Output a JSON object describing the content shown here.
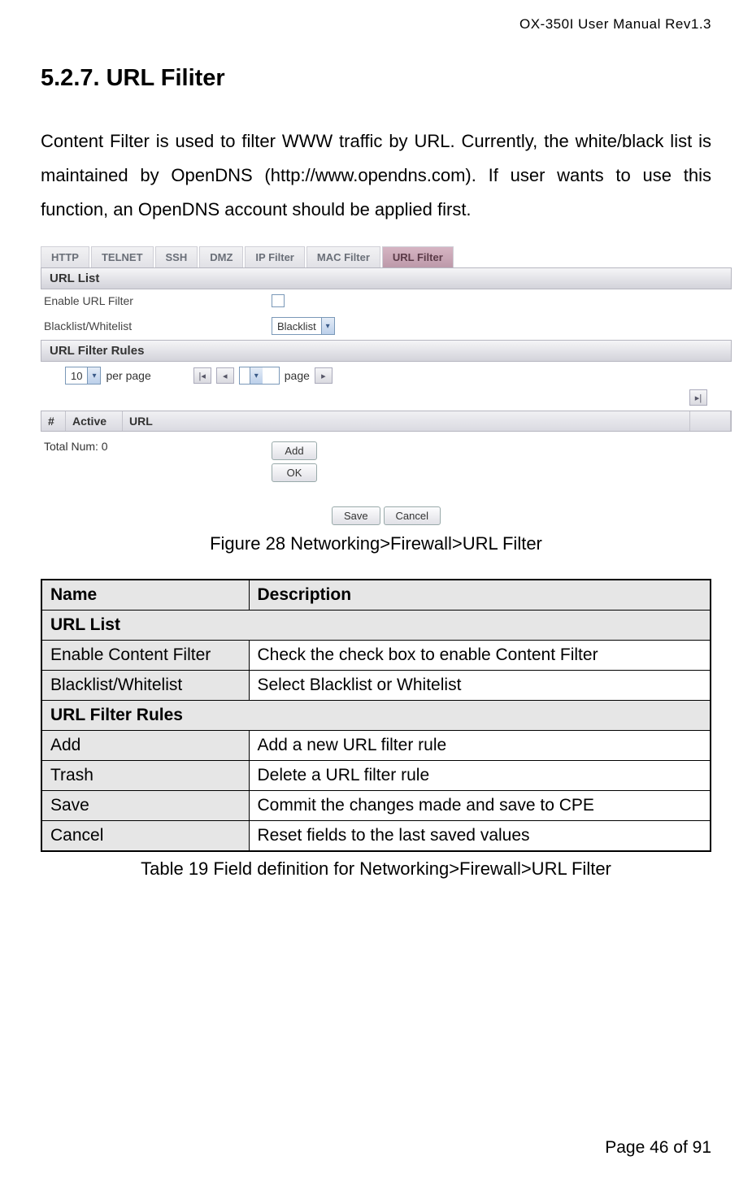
{
  "doc_header": "OX-350I  User  Manual  Rev1.3",
  "section_title": "5.2.7. URL Filiter",
  "intro": "Content Filter is used to filter WWW traffic by URL. Currently, the white/black list is maintained by OpenDNS (http://www.opendns.com). If user wants to use this function, an OpenDNS account should be applied first.",
  "screenshot": {
    "tabs": [
      "HTTP",
      "TELNET",
      "SSH",
      "DMZ",
      "IP Filter",
      "MAC Filter",
      "URL Filter"
    ],
    "active_tab_index": 6,
    "section1": "URL List",
    "enable_label": "Enable URL Filter",
    "bw_label": "Blacklist/Whitelist",
    "bw_value": "Blacklist",
    "section2": "URL Filter Rules",
    "per_page_value": "10",
    "per_page_label": "per page",
    "page_label": "page",
    "cols": {
      "num": "#",
      "active": "Active",
      "url": "URL"
    },
    "total_label": "Total Num: 0",
    "add_btn": "Add",
    "ok_btn": "OK",
    "save_btn": "Save",
    "cancel_btn": "Cancel"
  },
  "figure_caption": "Figure 28      Networking>Firewall>URL Filter",
  "table": {
    "head_name": "Name",
    "head_desc": "Description",
    "sec1": "URL List",
    "rows1": [
      {
        "name": "Enable Content Filter",
        "desc": "Check the check box to enable Content Filter"
      },
      {
        "name": "Blacklist/Whitelist",
        "desc": "Select Blacklist or Whitelist"
      }
    ],
    "sec2": "URL Filter Rules",
    "rows2": [
      {
        "name": "Add",
        "desc": "Add a new URL filter rule"
      },
      {
        "name": "Trash",
        "desc": "Delete a URL filter rule"
      },
      {
        "name": "Save",
        "desc": "Commit the changes made and save to CPE"
      },
      {
        "name": "Cancel",
        "desc": "Reset fields to the last saved values"
      }
    ]
  },
  "table_caption": "Table 19 Field definition for Networking>Firewall>URL Filter",
  "footer": "Page 46 of 91"
}
